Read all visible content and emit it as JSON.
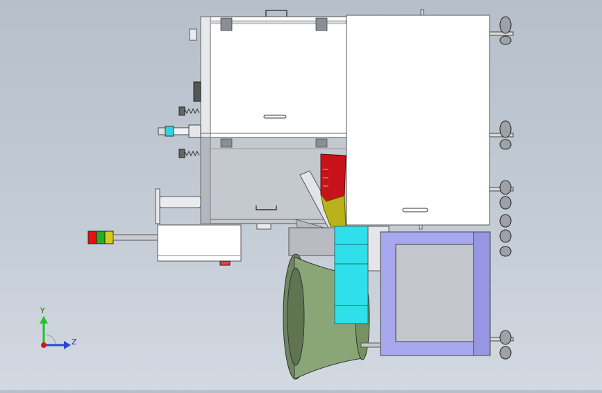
{
  "triad": {
    "y_label": "Y",
    "z_label": "Z",
    "colors": {
      "y": "#22c22a",
      "z": "#2846d8",
      "x": "#d81818"
    }
  },
  "palette": {
    "cabinet": "#ffffff",
    "interior": "#c4c8cf",
    "hopper_red": "#c8121a",
    "hopper_yellow": "#b9b21a",
    "feeder_cyan": "#2fe0ea",
    "frame_lilac": "#a8a8ee",
    "bowl_green": "#7f9a6c"
  },
  "stack_light": {
    "colors": [
      "#e81010",
      "#20b020",
      "#d8c818"
    ]
  }
}
